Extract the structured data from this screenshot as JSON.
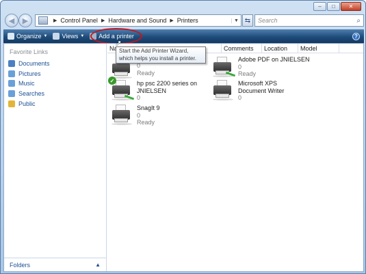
{
  "window": {
    "caption_buttons": {
      "minimize": "–",
      "maximize": "□",
      "close": "✕"
    }
  },
  "address": {
    "breadcrumbs": [
      "Control Panel",
      "Hardware and Sound",
      "Printers"
    ],
    "search_placeholder": "Search"
  },
  "toolbar": {
    "organize_label": "Organize",
    "views_label": "Views",
    "add_printer_label": "Add a printer",
    "help_label": "?"
  },
  "sidebar": {
    "title": "Favorite Links",
    "items": [
      {
        "label": "Documents",
        "icon": "documents-icon",
        "color": "#4c7fc4"
      },
      {
        "label": "Pictures",
        "icon": "pictures-icon",
        "color": "#6aa0d8"
      },
      {
        "label": "Music",
        "icon": "music-icon",
        "color": "#6aa0d8"
      },
      {
        "label": "Searches",
        "icon": "searches-icon",
        "color": "#6aa0d8"
      },
      {
        "label": "Public",
        "icon": "public-folder-icon",
        "color": "#e2b43a"
      }
    ],
    "folders_label": "Folders"
  },
  "columns": [
    "Na",
    "Comments",
    "Location",
    "Model"
  ],
  "printers": [
    {
      "name": "",
      "count": "0",
      "status": "Ready",
      "default": false
    },
    {
      "name": "Adobe PDF on JNIELSEN",
      "count": "0",
      "status": "Ready",
      "default": false
    },
    {
      "name": "hp psc 2200 series on JNIELSEN",
      "name_line2": "",
      "count": "0",
      "status": "",
      "default": true
    },
    {
      "name": "Microsoft XPS Document Writer",
      "count": "0",
      "status": "",
      "default": false
    },
    {
      "name": "SnagIt 9",
      "count": "0",
      "status": "Ready",
      "default": false
    }
  ],
  "tooltip": {
    "text": "Start the Add Printer Wizard, which helps you install a printer."
  },
  "colors": {
    "toolbar": "#1f4c7a",
    "link": "#1c4f95",
    "highlight_ring": "#c4161c"
  }
}
